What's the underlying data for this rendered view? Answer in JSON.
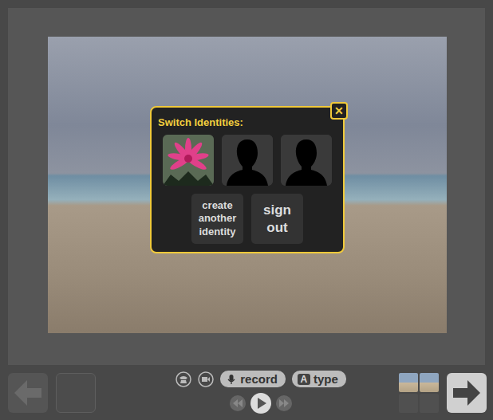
{
  "dialog": {
    "title": "Switch Identities:",
    "close": "✕",
    "identities": [
      {
        "kind": "photo"
      },
      {
        "kind": "silhouette"
      },
      {
        "kind": "silhouette"
      }
    ],
    "actions": [
      {
        "label": "create another identity",
        "size": "small"
      },
      {
        "label": "sign out",
        "size": "large"
      }
    ]
  },
  "toolbar": {
    "record": {
      "label": "record"
    },
    "type": {
      "badge": "A",
      "label": "type"
    }
  },
  "nav": {
    "back_disabled": true,
    "forward_disabled": false
  },
  "thumbnails": [
    {
      "kind": "photo"
    },
    {
      "kind": "photo"
    },
    {
      "kind": "empty"
    },
    {
      "kind": "empty"
    }
  ]
}
